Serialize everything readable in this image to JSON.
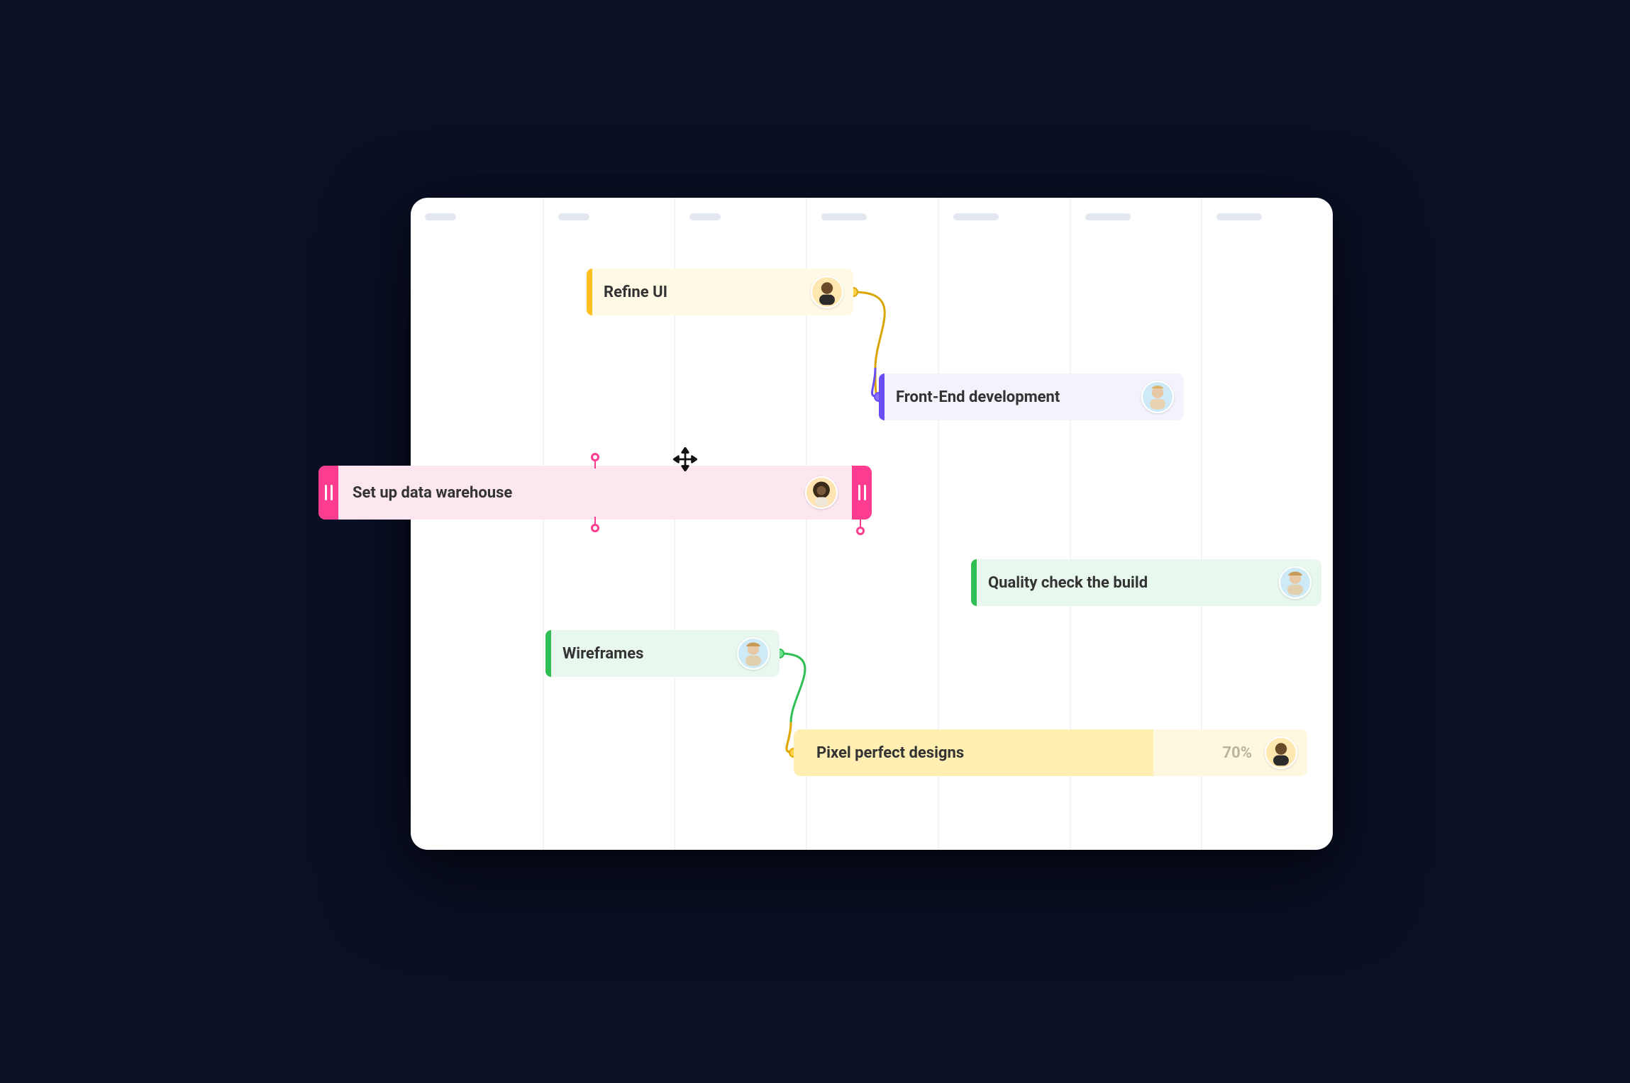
{
  "tasks": {
    "refine": {
      "label": "Refine UI",
      "accent": "#ffbf1f",
      "bg": "#fffae5"
    },
    "fed": {
      "label": "Front-End development",
      "accent": "#6a4df5",
      "bg": "#f3f4fb"
    },
    "data": {
      "label": "Set up data warehouse",
      "accent": "#ff3d90",
      "bg": "#fce6f0"
    },
    "qc": {
      "label": "Quality check the build",
      "accent": "#2fbf55",
      "bg": "#e9f8ee"
    },
    "wire": {
      "label": "Wireframes",
      "accent": "#2fbf55",
      "bg": "#e9f8ee"
    },
    "pixel": {
      "label": "Pixel perfect designs",
      "accent": "#ffb000",
      "bg": "#fff8e0",
      "progress_label": "70%",
      "progress_pct": 70
    }
  }
}
